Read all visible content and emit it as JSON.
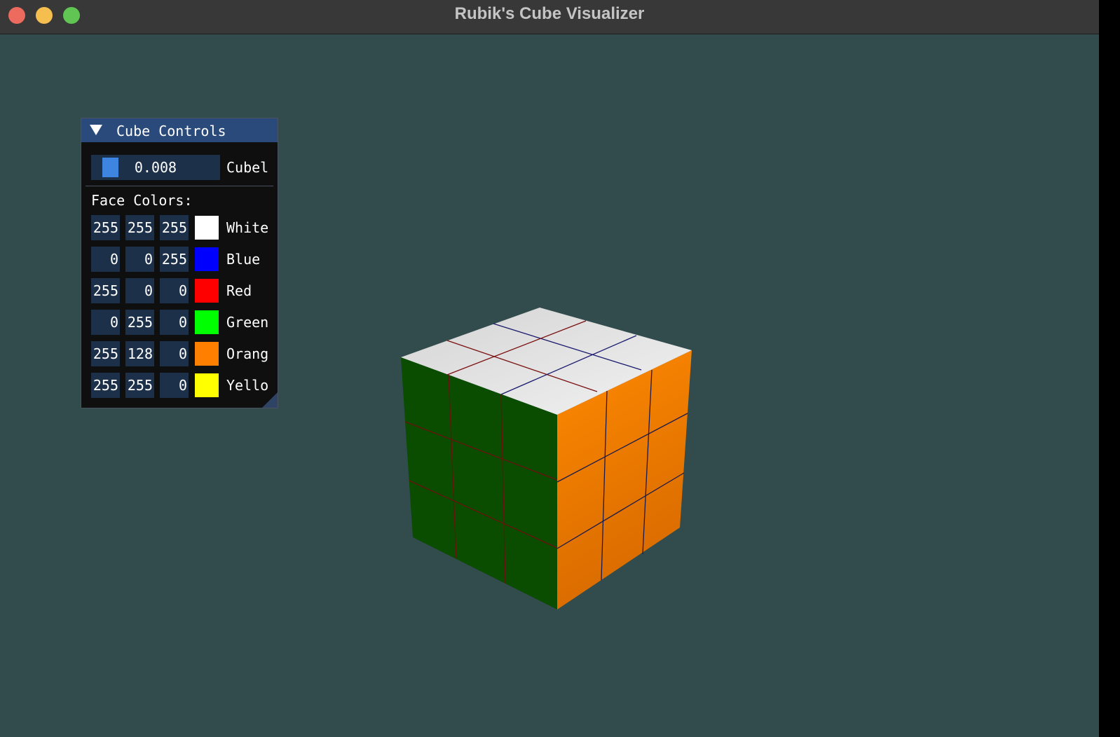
{
  "window": {
    "title": "Rubik's Cube Visualizer"
  },
  "panel": {
    "title": "Cube Controls",
    "slider": {
      "value": "0.008",
      "label": "Cubel"
    },
    "face_colors_label": "Face Colors:",
    "colors": [
      {
        "r": "255",
        "g": "255",
        "b": "255",
        "name": "White",
        "hex": "#ffffff"
      },
      {
        "r": "0",
        "g": "0",
        "b": "255",
        "name": "Blue",
        "hex": "#0000ff"
      },
      {
        "r": "255",
        "g": "0",
        "b": "0",
        "name": "Red",
        "hex": "#ff0000"
      },
      {
        "r": "0",
        "g": "255",
        "b": "0",
        "name": "Green",
        "hex": "#00ff00"
      },
      {
        "r": "255",
        "g": "128",
        "b": "0",
        "name": "Orang",
        "hex": "#ff8000"
      },
      {
        "r": "255",
        "g": "255",
        "b": "0",
        "name": "Yello",
        "hex": "#ffff00"
      }
    ]
  },
  "colors": {
    "background": "#324c4d",
    "panel_header": "#2a4a7b",
    "input_bg": "#1d3049",
    "cube_top": "#e6e6e6",
    "cube_left": "#0a4d00",
    "cube_right": "#f07d00"
  }
}
